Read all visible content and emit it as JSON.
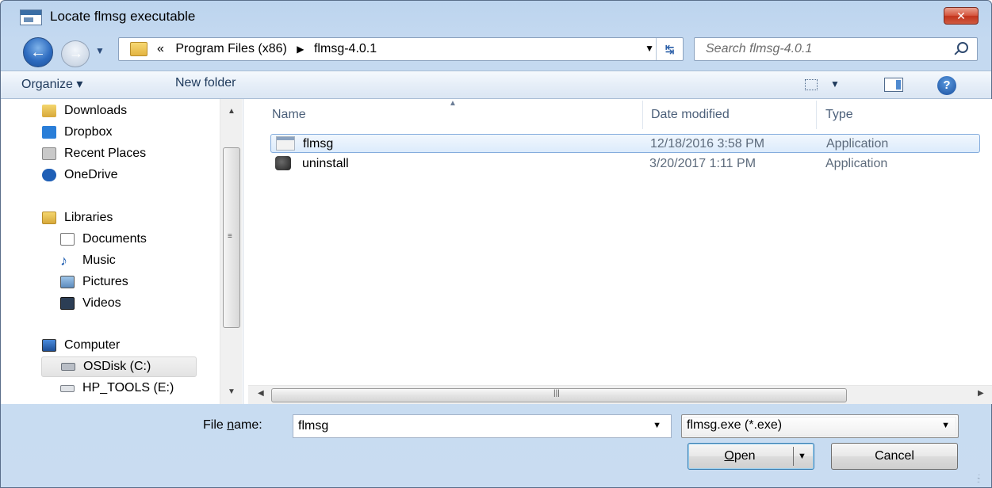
{
  "window": {
    "title": "Locate flmsg executable",
    "close_label": "✕"
  },
  "nav": {
    "path": [
      "«",
      "Program Files (x86)",
      "flmsg-4.0.1"
    ],
    "search_placeholder": "Search flmsg-4.0.1"
  },
  "toolbar": {
    "organize": "Organize ▾",
    "new_folder": "New folder"
  },
  "sidebar": {
    "items": [
      {
        "label": "Downloads",
        "icon": "downloads-icon"
      },
      {
        "label": "Dropbox",
        "icon": "dropbox-icon"
      },
      {
        "label": "Recent Places",
        "icon": "recent-places-icon"
      },
      {
        "label": "OneDrive",
        "icon": "onedrive-icon"
      },
      {
        "label": "Libraries",
        "icon": "libraries-icon"
      },
      {
        "label": "Documents",
        "icon": "documents-icon"
      },
      {
        "label": "Music",
        "icon": "music-icon"
      },
      {
        "label": "Pictures",
        "icon": "pictures-icon"
      },
      {
        "label": "Videos",
        "icon": "videos-icon"
      },
      {
        "label": "Computer",
        "icon": "computer-icon"
      },
      {
        "label": "OSDisk (C:)",
        "icon": "disk-icon",
        "selected": true
      },
      {
        "label": "HP_TOOLS (E:)",
        "icon": "drive-icon"
      }
    ]
  },
  "files": {
    "columns": [
      "Name",
      "Date modified",
      "Type"
    ],
    "rows": [
      {
        "name": "flmsg",
        "date": "12/18/2016 3:58 PM",
        "type": "Application",
        "selected": true
      },
      {
        "name": "uninstall",
        "date": "3/20/2017 1:11 PM",
        "type": "Application",
        "selected": false
      }
    ]
  },
  "footer": {
    "file_name_label_pre": "File ",
    "file_name_label_ul": "n",
    "file_name_label_post": "ame:",
    "file_name_value": "flmsg",
    "filter_value": "flmsg.exe (*.exe)",
    "open_ul": "O",
    "open_rest": "pen",
    "cancel": "Cancel"
  },
  "colors": {
    "accent": "#3c7fb1",
    "selection": "#dcebfc",
    "chrome": "#c9dcf1"
  }
}
